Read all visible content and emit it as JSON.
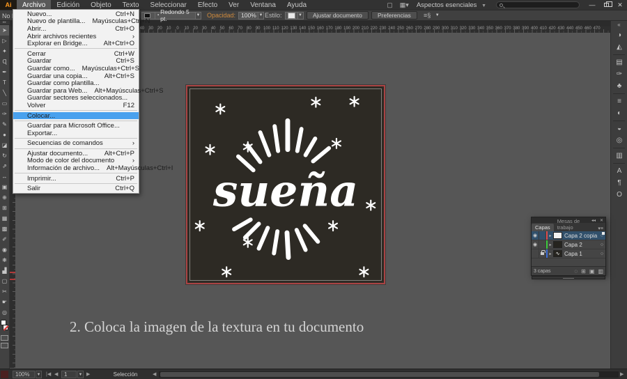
{
  "titlebar": {
    "logo": "Ai",
    "menus": [
      "Archivo",
      "Edición",
      "Objeto",
      "Texto",
      "Seleccionar",
      "Efecto",
      "Ver",
      "Ventana",
      "Ayuda"
    ],
    "active_menu": "Archivo",
    "workspace": "Aspectos esenciales"
  },
  "control_bar": {
    "selection_status": "No hay selección",
    "brush_value": "Redondo 5 pt.",
    "opacity_label": "Opacidad:",
    "opacity_value": "100%",
    "style_label": "Estilo:",
    "fit_document_button": "Ajustar documento",
    "preferences_button": "Preferencias"
  },
  "file_menu": {
    "items": [
      {
        "label": "Nuevo...",
        "shortcut": "Ctrl+N"
      },
      {
        "label": "Nuevo de plantilla...",
        "shortcut": "Mayúsculas+Ctrl+N"
      },
      {
        "label": "Abrir...",
        "shortcut": "Ctrl+O"
      },
      {
        "label": "Abrir archivos recientes",
        "submenu": true
      },
      {
        "label": "Explorar en Bridge...",
        "shortcut": "Alt+Ctrl+O",
        "separator_after": true
      },
      {
        "label": "Cerrar",
        "shortcut": "Ctrl+W"
      },
      {
        "label": "Guardar",
        "shortcut": "Ctrl+S"
      },
      {
        "label": "Guardar como...",
        "shortcut": "Mayúsculas+Ctrl+S"
      },
      {
        "label": "Guardar una copia...",
        "shortcut": "Alt+Ctrl+S"
      },
      {
        "label": "Guardar como plantilla..."
      },
      {
        "label": "Guardar para Web...",
        "shortcut": "Alt+Mayúsculas+Ctrl+S"
      },
      {
        "label": "Guardar sectores seleccionados..."
      },
      {
        "label": "Volver",
        "shortcut": "F12",
        "separator_after": true
      },
      {
        "label": "Colocar...",
        "highlighted": true,
        "separator_after": true
      },
      {
        "label": "Guardar para Microsoft Office..."
      },
      {
        "label": "Exportar...",
        "separator_after": true
      },
      {
        "label": "Secuencias de comandos",
        "submenu": true,
        "separator_after": true
      },
      {
        "label": "Ajustar documento...",
        "shortcut": "Alt+Ctrl+P"
      },
      {
        "label": "Modo de color del documento",
        "submenu": true
      },
      {
        "label": "Información de archivo...",
        "shortcut": "Alt+Mayúsculas+Ctrl+I",
        "separator_after": true
      },
      {
        "label": "Imprimir...",
        "shortcut": "Ctrl+P",
        "separator_after": true
      },
      {
        "label": "Salir",
        "shortcut": "Ctrl+Q"
      }
    ]
  },
  "ruler": {
    "labels": [
      50,
      40,
      30,
      20,
      10,
      0,
      10,
      20,
      30,
      40,
      50,
      60,
      70,
      80,
      90,
      100,
      110,
      120,
      130,
      140,
      150,
      160,
      170,
      180,
      190,
      200,
      210,
      220,
      230,
      240,
      250,
      260,
      270,
      280,
      290,
      300,
      310,
      320,
      330,
      340,
      350,
      360,
      370,
      380,
      390,
      400,
      410,
      420,
      430,
      440,
      450,
      460,
      470
    ]
  },
  "toolbar": {
    "tools": [
      {
        "name": "selection-tool",
        "glyph": "➤",
        "active": true
      },
      {
        "name": "direct-selection-tool",
        "glyph": "▷"
      },
      {
        "name": "magic-wand-tool",
        "glyph": "✦"
      },
      {
        "name": "lasso-tool",
        "glyph": "Ɋ"
      },
      {
        "name": "pen-tool",
        "glyph": "✒"
      },
      {
        "name": "type-tool",
        "glyph": "T"
      },
      {
        "name": "line-segment-tool",
        "glyph": "╲"
      },
      {
        "name": "rectangle-tool",
        "glyph": "▭"
      },
      {
        "name": "paintbrush-tool",
        "glyph": "✑"
      },
      {
        "name": "pencil-tool",
        "glyph": "✎"
      },
      {
        "name": "blob-brush-tool",
        "glyph": "●"
      },
      {
        "name": "eraser-tool",
        "glyph": "◪"
      },
      {
        "name": "rotate-tool",
        "glyph": "↻"
      },
      {
        "name": "scale-tool",
        "glyph": "⇗"
      },
      {
        "name": "width-tool",
        "glyph": "↔"
      },
      {
        "name": "free-transform-tool",
        "glyph": "▣"
      },
      {
        "name": "shape-builder-tool",
        "glyph": "⊕"
      },
      {
        "name": "perspective-grid-tool",
        "glyph": "⊞"
      },
      {
        "name": "mesh-tool",
        "glyph": "▦"
      },
      {
        "name": "gradient-tool",
        "glyph": "▩"
      },
      {
        "name": "eyedropper-tool",
        "glyph": "✐"
      },
      {
        "name": "blend-tool",
        "glyph": "◉"
      },
      {
        "name": "symbol-sprayer-tool",
        "glyph": "❋"
      },
      {
        "name": "column-graph-tool",
        "glyph": "▟"
      },
      {
        "name": "artboard-tool",
        "glyph": "▢"
      },
      {
        "name": "slice-tool",
        "glyph": "✂"
      },
      {
        "name": "hand-tool",
        "glyph": "☛"
      },
      {
        "name": "zoom-tool",
        "glyph": "◎"
      }
    ]
  },
  "dock": {
    "groups": [
      {
        "items": [
          {
            "name": "color-panel-icon",
            "glyph": "◑"
          },
          {
            "name": "color-guide-panel-icon",
            "glyph": "◭"
          }
        ]
      },
      {
        "items": [
          {
            "name": "swatches-panel-icon",
            "glyph": "▤"
          },
          {
            "name": "brushes-panel-icon",
            "glyph": "✑"
          },
          {
            "name": "symbols-panel-icon",
            "glyph": "♣"
          }
        ]
      },
      {
        "items": [
          {
            "name": "stroke-panel-icon",
            "glyph": "≡"
          },
          {
            "name": "gradient-panel-icon",
            "glyph": "◐"
          }
        ]
      },
      {
        "items": [
          {
            "name": "transparency-panel-icon",
            "glyph": "◒"
          },
          {
            "name": "appearance-panel-icon",
            "glyph": "◎"
          }
        ]
      },
      {
        "items": [
          {
            "name": "artboards-panel-icon",
            "glyph": "▥"
          }
        ]
      },
      {
        "items": [
          {
            "name": "character-panel-icon",
            "glyph": "A"
          },
          {
            "name": "paragraph-panel-icon",
            "glyph": "¶"
          },
          {
            "name": "opentype-panel-icon",
            "glyph": "O"
          }
        ]
      }
    ]
  },
  "canvas": {
    "artwork": {
      "word": "sueña"
    },
    "caption": "2. Coloca la imagen de la textura en tu documento"
  },
  "layers_panel": {
    "tabs": [
      "Capas",
      "Mesas de trabajo"
    ],
    "layers": [
      {
        "name": "Capa 2 copia",
        "color": "#e04c4c",
        "visible": true,
        "locked": false,
        "selected": true,
        "thumb": "white"
      },
      {
        "name": "Capa 2",
        "color": "#3ecc3e",
        "visible": true,
        "locked": false,
        "selected": false,
        "thumb": "dark"
      },
      {
        "name": "Capa 1",
        "color": "#3e6fd9",
        "visible": false,
        "locked": true,
        "selected": false,
        "thumb": "art"
      }
    ],
    "footer_count": "3 capas"
  },
  "status_bar": {
    "zoom": "100%",
    "artboard": "1",
    "tool_readout": "Selección"
  }
}
